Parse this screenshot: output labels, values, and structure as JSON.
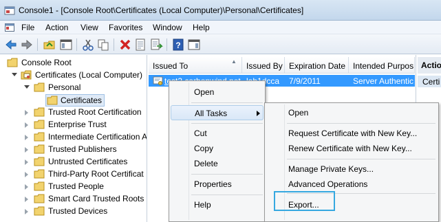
{
  "window": {
    "title": "Console1 - [Console Root\\Certificates (Local Computer)\\Personal\\Certificates]"
  },
  "menubar": {
    "items": [
      "File",
      "Action",
      "View",
      "Favorites",
      "Window",
      "Help"
    ]
  },
  "toolbar": {
    "buttons": [
      "back-icon",
      "forward-icon",
      "up-folder-icon",
      "show-tree-icon",
      "cut-icon",
      "copy-icon",
      "delete-icon",
      "properties-icon",
      "export-list-icon",
      "help-icon",
      "action-pane-icon"
    ]
  },
  "tree": {
    "items": [
      {
        "label": "Console Root",
        "level": 0
      },
      {
        "label": "Certificates (Local Computer)",
        "level": 1,
        "expanded": true
      },
      {
        "label": "Personal",
        "level": 2,
        "expanded": true
      },
      {
        "label": "Certificates",
        "level": 3,
        "selected": true
      },
      {
        "label": "Trusted Root Certification",
        "level": 2
      },
      {
        "label": "Enterprise Trust",
        "level": 2
      },
      {
        "label": "Intermediate Certification A",
        "level": 2
      },
      {
        "label": "Trusted Publishers",
        "level": 2
      },
      {
        "label": "Untrusted Certificates",
        "level": 2
      },
      {
        "label": "Third-Party Root Certificat",
        "level": 2
      },
      {
        "label": "Trusted People",
        "level": 2
      },
      {
        "label": "Smart Card Trusted Roots",
        "level": 2
      },
      {
        "label": "Trusted Devices",
        "level": 2
      }
    ]
  },
  "list": {
    "columns": [
      "Issued To",
      "Issued By",
      "Expiration Date",
      "Intended Purpos"
    ],
    "rows": [
      {
        "issued_to": "test2.carbonwind.net",
        "issued_by": "lab1dcca",
        "expiration": "7/9/2011",
        "purpose": "Server Authentic"
      }
    ]
  },
  "actions": {
    "header": "Actio",
    "item": "Certi"
  },
  "context_menu": {
    "items": [
      "Open",
      "All Tasks",
      "Cut",
      "Copy",
      "Delete",
      "Properties",
      "Help"
    ],
    "hovered": "All Tasks"
  },
  "submenu": {
    "items": [
      "Open",
      "Request Certificate with New Key...",
      "Renew Certificate with New Key...",
      "Manage Private Keys...",
      "Advanced Operations",
      "Export..."
    ],
    "highlighted": "Export...",
    "highlight_color": "#35a8e0"
  }
}
